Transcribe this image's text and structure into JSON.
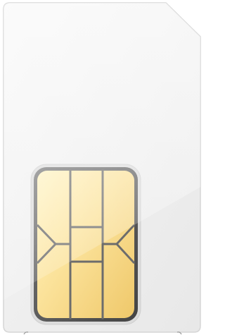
{
  "image": {
    "subject": "sim-card",
    "card_color": "#eeeeee",
    "card_edge_color": "#d6d6d6",
    "chip_frame_color": "#555555",
    "chip_gold_light": "#fff0b4",
    "chip_gold_dark": "#efc86a",
    "chip_line_color": "#6c6c6c"
  }
}
